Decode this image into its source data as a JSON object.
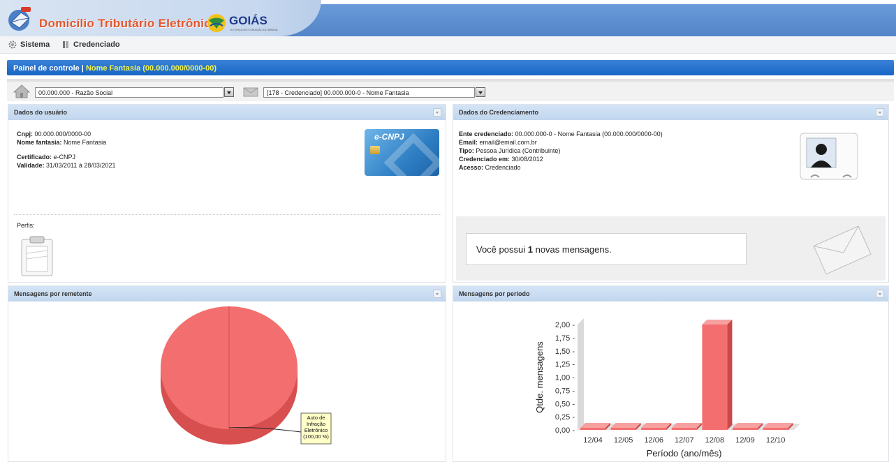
{
  "header": {
    "app_title": "Domicílio Tributário Eletrônico",
    "state_logo": "GOIÁS",
    "state_logo_sub": "A FORÇA DO CORAÇÃO DO BRASIL"
  },
  "menu": {
    "items": [
      {
        "label": "Sistema",
        "icon": "gear-icon"
      },
      {
        "label": "Credenciado",
        "icon": "book-icon"
      }
    ]
  },
  "title_bar": {
    "prefix": "Painel de controle  |",
    "highlight": "Nome Fantasia (00.000.000/0000-00)"
  },
  "selectors": {
    "company": "00.000.000 - Razão Social",
    "accreditation": "[178 - Credenciado] 00.000.000-0 - Nome Fantasia"
  },
  "user_panel": {
    "title": "Dados do usuário",
    "cnpj_label": "Cnpj:",
    "cnpj_value": "00.000.000/0000-00",
    "name_label": "Nome fantasia:",
    "name_value": "Nome Fantasia",
    "cert_label": "Certificado:",
    "cert_value": "e-CNPJ",
    "validity_label": "Validade:",
    "validity_value": "31/03/2011 à 28/03/2021",
    "card_label": "e-CNPJ",
    "profiles_label": "Perfis:"
  },
  "accreditation_panel": {
    "title": "Dados do Credenciamento",
    "ente_label": "Ente credenciado:",
    "ente_value": "00.000.000-0 - Nome Fantasia (00.000.000/0000-00)",
    "email_label": "Email:",
    "email_value": "email@email.com.br",
    "tipo_label": "Tipo:",
    "tipo_value": "Pessoa Jurídica (Contribuinte)",
    "date_label": "Credenciado em:",
    "date_value": "30/08/2012",
    "access_label": "Acesso:",
    "access_value": "Credenciado",
    "messages_prefix": "Você possui",
    "messages_count": "1",
    "messages_suffix": "novas mensagens."
  },
  "sender_panel": {
    "title": "Mensagens por remetente"
  },
  "period_panel": {
    "title": "Mensagens por período"
  },
  "chart_data": [
    {
      "type": "pie",
      "labels": [
        "Auto de Infração Eletrônico (100,00 %)"
      ],
      "values": [
        100
      ],
      "colors": [
        "#f36f6f"
      ]
    },
    {
      "type": "bar",
      "categories": [
        "12/04",
        "12/05",
        "12/06",
        "12/07",
        "12/08",
        "12/09",
        "12/10"
      ],
      "values": [
        0,
        0,
        0,
        0,
        2,
        0,
        0
      ],
      "xlabel": "Período (ano/mês)",
      "ylabel": "Qtde. mensagens",
      "yticks": [
        "0,00",
        "0,25",
        "0,50",
        "0,75",
        "1,00",
        "1,25",
        "1,50",
        "1,75",
        "2,00"
      ],
      "ylim": [
        0,
        2
      ],
      "color": "#f36f6f"
    }
  ]
}
